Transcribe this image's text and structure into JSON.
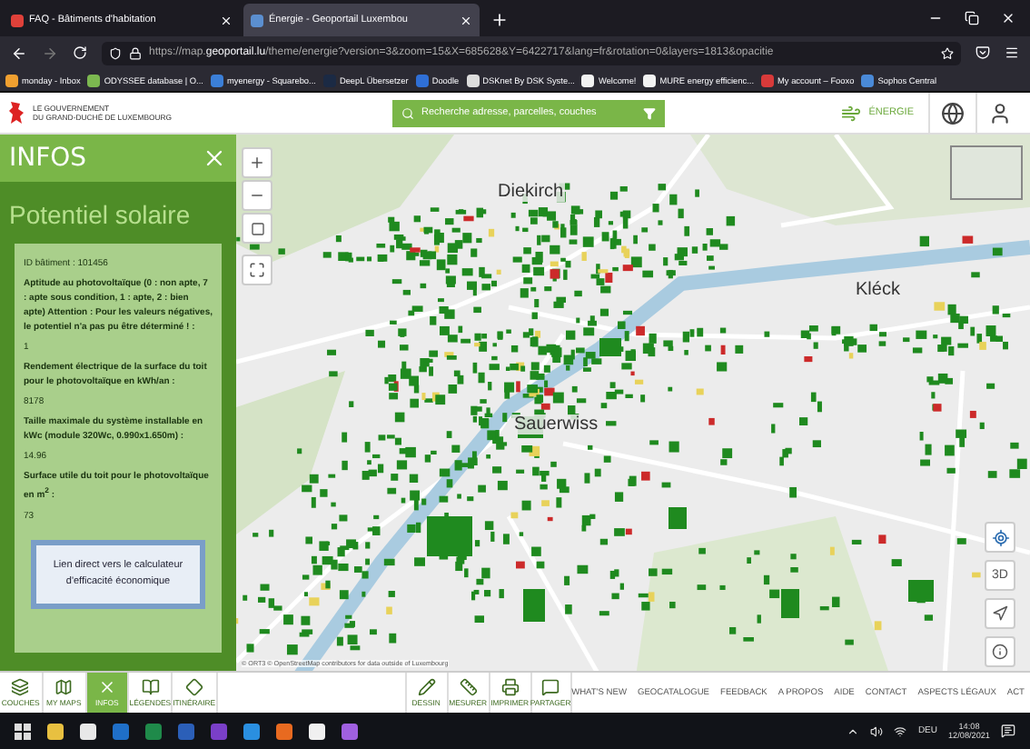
{
  "browser": {
    "tabs": [
      {
        "title": "FAQ - Bâtiments d'habitation",
        "selected": false,
        "color": "#e0413a"
      },
      {
        "title": "Énergie - Geoportail Luxembou",
        "selected": true,
        "color": "#5b8fd0"
      }
    ],
    "url_prefix": "https://map.",
    "url_host": "geoportail.lu",
    "url_rest": "/theme/energie?version=3&zoom=15&X=685628&Y=6422717&lang=fr&rotation=0&layers=1813&opacitie",
    "bookmarks": [
      {
        "label": "monday - Inbox",
        "color": "#f0a030"
      },
      {
        "label": "ODYSSEE database | O...",
        "color": "#7cb850"
      },
      {
        "label": "myenergy - Squarebo...",
        "color": "#3b7fd8"
      },
      {
        "label": "DeepL Übersetzer",
        "color": "#1b2a44"
      },
      {
        "label": "Doodle",
        "color": "#2f6fd6"
      },
      {
        "label": "DSKnet By DSK Syste...",
        "color": "#dddddd"
      },
      {
        "label": "Welcome!",
        "color": "#f2f2f2"
      },
      {
        "label": "MURE energy efficienc...",
        "color": "#f2f2f2"
      },
      {
        "label": "My account – Fooxo",
        "color": "#d83a3a"
      },
      {
        "label": "Sophos Central",
        "color": "#4a8ad8"
      }
    ]
  },
  "header": {
    "org_lines": [
      "LE GOUVERNEMENT",
      "DU GRAND-DUCHÉ DE LUXEMBOURG"
    ],
    "search_placeholder": "Recherche adresse, parcelles, couches",
    "theme": "ÉNERGIE"
  },
  "panel": {
    "title": "INFOS",
    "heading": "Potentiel solaire",
    "id_line": "ID bâtiment : 101456",
    "attributes": [
      {
        "label": "Aptitude au photovoltaïque (0 : non apte, 7 : apte sous condition, 1 : apte, 2 : bien apte) Attention : Pour les valeurs négatives, le potentiel n'a pas pu être déterminé ! :",
        "value": "1"
      },
      {
        "label": "Rendement électrique de la surface du toit pour le photovoltaïque en kWh/an :",
        "value": "8178"
      },
      {
        "label": "Taille maximale du système installable en kWc (module 320Wc, 0.990x1.650m) :",
        "value": "14.96"
      },
      {
        "label": "Surface utile du toit pour le photovoltaïque en m$^{2}$ :",
        "value": "73"
      }
    ],
    "link_button": "Lien direct vers le calculateur d'efficacité économique"
  },
  "map": {
    "places": [
      "Diekirch",
      "Kléck",
      "Sauerwiss"
    ],
    "attribution": "© ORT3 © OpenStreetMap contributors for data outside of Luxembourg",
    "view_3d": "3D"
  },
  "bottom_tabs": [
    {
      "label": "COUCHES",
      "selected": false,
      "kind": "layers"
    },
    {
      "label": "MY MAPS",
      "selected": false,
      "kind": "maps"
    },
    {
      "label": "INFOS",
      "selected": true,
      "kind": "infos"
    },
    {
      "label": "LÉGENDES",
      "selected": false,
      "kind": "legends"
    },
    {
      "label": "ITINÉRAIRE",
      "selected": false,
      "kind": "route"
    }
  ],
  "tools": [
    {
      "label": "DESSIN",
      "kind": "draw"
    },
    {
      "label": "MESURER",
      "kind": "measure"
    },
    {
      "label": "IMPRIMER",
      "kind": "print"
    },
    {
      "label": "PARTAGER",
      "kind": "share"
    }
  ],
  "footer_links": [
    "WHAT'S NEW",
    "GEOCATALOGUE",
    "FEEDBACK",
    "A PROPOS",
    "AIDE",
    "CONTACT",
    "ASPECTS LÉGAUX",
    "ACT"
  ],
  "taskbar": {
    "apps": [
      {
        "color": "#e8c040"
      },
      {
        "color": "#e8e8e8"
      },
      {
        "color": "#1f6fc8"
      },
      {
        "color": "#1f8a4a"
      },
      {
        "color": "#2b5fb8"
      },
      {
        "color": "#7a3fc8"
      },
      {
        "color": "#2a8fe0"
      },
      {
        "color": "#e86a20"
      },
      {
        "color": "#f0f0f0"
      },
      {
        "color": "#a060e0"
      }
    ],
    "language": "DEU",
    "time": "14:08",
    "date": "12/08/2021"
  }
}
